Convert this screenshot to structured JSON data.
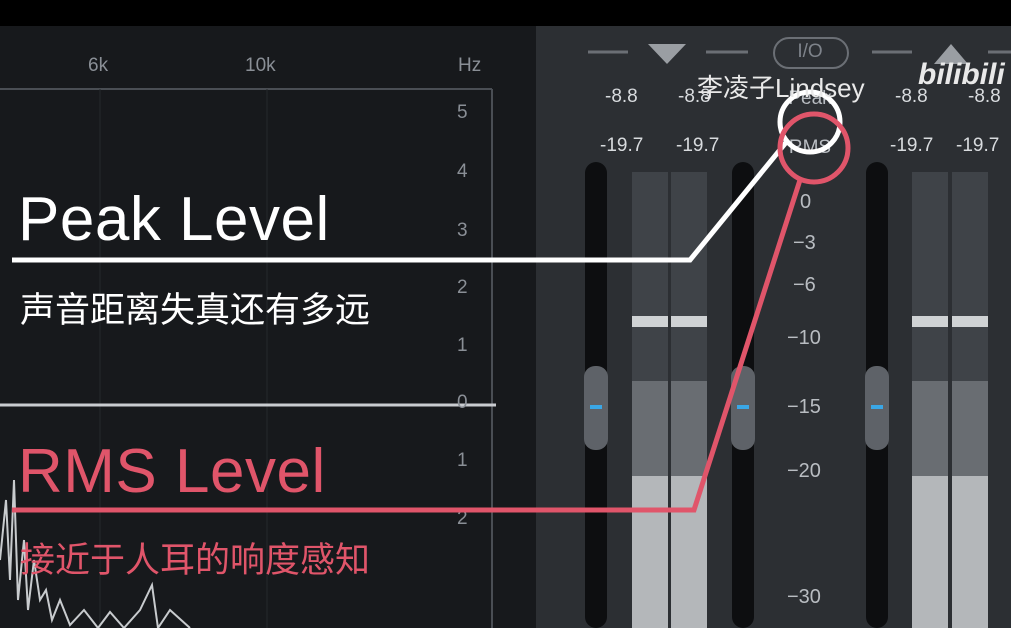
{
  "watermark": {
    "author": "李凌子Lindsey",
    "logo": "bilibili"
  },
  "spectrum": {
    "freq_labels": [
      "6k",
      "10k",
      "Hz"
    ],
    "scale": [
      "5",
      "4",
      "3",
      "2",
      "1",
      "0",
      "1",
      "2"
    ]
  },
  "meters": {
    "io_label": "I/O",
    "peak_label": "Peak",
    "rms_label": "RMS",
    "input": {
      "peak_values": [
        "-8.8",
        "-8.8"
      ],
      "rms_values": [
        "-19.7",
        "-19.7"
      ]
    },
    "output": {
      "peak_values": [
        "-8.8",
        "-8.8"
      ],
      "rms_values": [
        "-19.7",
        "-19.7"
      ]
    },
    "db_scale": [
      "0",
      "−3",
      "−6",
      "−10",
      "−15",
      "−20",
      "−30"
    ]
  },
  "annotations": {
    "peak": {
      "title": "Peak Level",
      "desc": "声音距离失真还有多远",
      "color": "#ffffff"
    },
    "rms": {
      "title": "RMS Level",
      "desc": "接近于人耳的响度感知",
      "color": "#e0556a"
    }
  }
}
